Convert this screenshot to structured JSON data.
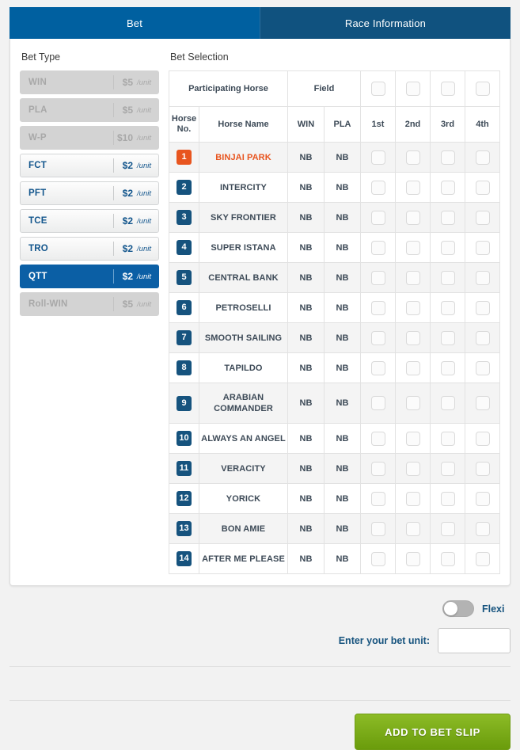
{
  "tabs": [
    {
      "label": "Bet",
      "active": true
    },
    {
      "label": "Race Information",
      "active": false
    }
  ],
  "bet_type": {
    "heading": "Bet Type",
    "items": [
      {
        "code": "WIN",
        "price": "$5",
        "unit": "/unit",
        "state": "disabled"
      },
      {
        "code": "PLA",
        "price": "$5",
        "unit": "/unit",
        "state": "disabled"
      },
      {
        "code": "W-P",
        "price": "$10",
        "unit": "/unit",
        "state": "disabled"
      },
      {
        "code": "FCT",
        "price": "$2",
        "unit": "/unit",
        "state": "enabled"
      },
      {
        "code": "PFT",
        "price": "$2",
        "unit": "/unit",
        "state": "enabled"
      },
      {
        "code": "TCE",
        "price": "$2",
        "unit": "/unit",
        "state": "enabled"
      },
      {
        "code": "TRO",
        "price": "$2",
        "unit": "/unit",
        "state": "enabled"
      },
      {
        "code": "QTT",
        "price": "$2",
        "unit": "/unit",
        "state": "selected"
      },
      {
        "code": "Roll-WIN",
        "price": "$5",
        "unit": "/unit",
        "state": "disabled"
      }
    ]
  },
  "bet_selection": {
    "heading": "Bet Selection",
    "header_participating": "Participating Horse",
    "header_field": "Field",
    "columns": {
      "horse_no_line1": "Horse",
      "horse_no_line2": "No.",
      "horse_name": "Horse Name",
      "win": "WIN",
      "pla": "PLA",
      "pos1": "1st",
      "pos2": "2nd",
      "pos3": "3rd",
      "pos4": "4th"
    },
    "rows": [
      {
        "no": "1",
        "name": "BINJAI PARK",
        "win": "NB",
        "pla": "NB",
        "highlight": true
      },
      {
        "no": "2",
        "name": "INTERCITY",
        "win": "NB",
        "pla": "NB",
        "highlight": false
      },
      {
        "no": "3",
        "name": "SKY FRONTIER",
        "win": "NB",
        "pla": "NB",
        "highlight": false
      },
      {
        "no": "4",
        "name": "SUPER ISTANA",
        "win": "NB",
        "pla": "NB",
        "highlight": false
      },
      {
        "no": "5",
        "name": "CENTRAL BANK",
        "win": "NB",
        "pla": "NB",
        "highlight": false
      },
      {
        "no": "6",
        "name": "PETROSELLI",
        "win": "NB",
        "pla": "NB",
        "highlight": false
      },
      {
        "no": "7",
        "name": "SMOOTH SAILING",
        "win": "NB",
        "pla": "NB",
        "highlight": false
      },
      {
        "no": "8",
        "name": "TAPILDO",
        "win": "NB",
        "pla": "NB",
        "highlight": false
      },
      {
        "no": "9",
        "name": "ARABIAN COMMANDER",
        "win": "NB",
        "pla": "NB",
        "highlight": false,
        "tall": true
      },
      {
        "no": "10",
        "name": "ALWAYS AN ANGEL",
        "win": "NB",
        "pla": "NB",
        "highlight": false
      },
      {
        "no": "11",
        "name": "VERACITY",
        "win": "NB",
        "pla": "NB",
        "highlight": false
      },
      {
        "no": "12",
        "name": "YORICK",
        "win": "NB",
        "pla": "NB",
        "highlight": false
      },
      {
        "no": "13",
        "name": "BON AMIE",
        "win": "NB",
        "pla": "NB",
        "highlight": false
      },
      {
        "no": "14",
        "name": "AFTER ME PLEASE",
        "win": "NB",
        "pla": "NB",
        "highlight": false
      }
    ]
  },
  "controls": {
    "flexi_label": "Flexi",
    "flexi_on": false,
    "bet_unit_label": "Enter your bet unit:",
    "bet_unit_value": "",
    "bet_unit_placeholder": "",
    "submit_label": "ADD TO BET SLIP"
  },
  "colors": {
    "tab_active": "#0060a0",
    "tab_inactive": "#10527f",
    "accent_navy": "#16537e",
    "accent_orange": "#e8551f",
    "selected_blue": "#0b5fa5",
    "submit_green": "#7aac1a"
  }
}
